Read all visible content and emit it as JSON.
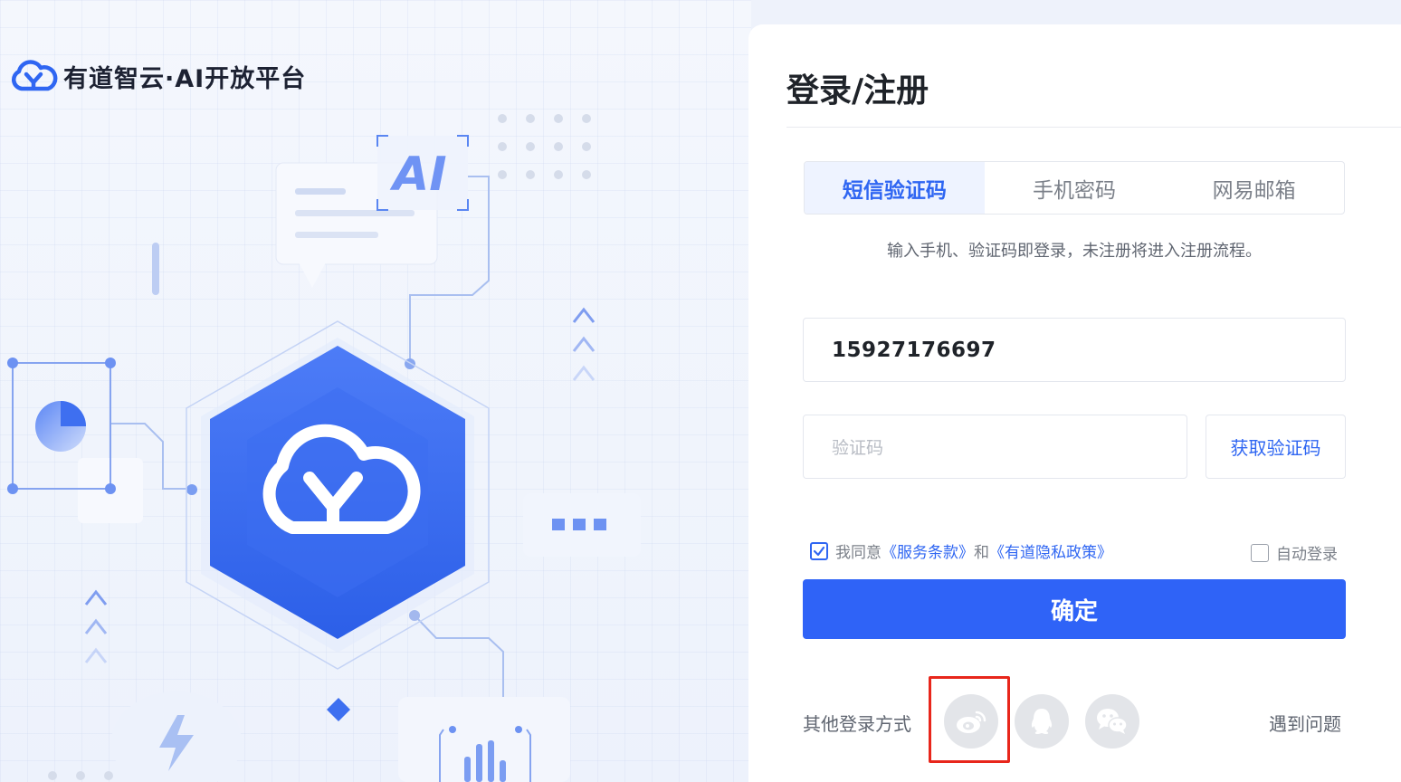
{
  "brand": {
    "name": "有道智云·AI开放平台",
    "logo_icon": "youdao-cloud-logo-icon",
    "accent": "#2f66f2"
  },
  "illustration": {
    "badge_text": "AI"
  },
  "login": {
    "title": "登录/注册",
    "tabs": [
      {
        "label": "短信验证码",
        "active": true
      },
      {
        "label": "手机密码",
        "active": false
      },
      {
        "label": "网易邮箱",
        "active": false
      }
    ],
    "hint": "输入手机、验证码即登录，未注册将进入注册流程。",
    "phone_value": "15927176697",
    "code_placeholder": "验证码",
    "get_code_label": "获取验证码",
    "agree_prefix": "我同意",
    "terms_link": "《服务条款》",
    "agree_and": "和",
    "privacy_link": "《有道隐私政策》",
    "agree_checked": true,
    "auto_login_label": "自动登录",
    "auto_login_checked": false,
    "confirm_label": "确定",
    "confirm_color": "#2f63f7",
    "other_login_label": "其他登录方式",
    "social": [
      "weibo-icon",
      "qq-icon",
      "wechat-icon"
    ],
    "problem_label": "遇到问题",
    "highlight_color": "#e8261b"
  }
}
